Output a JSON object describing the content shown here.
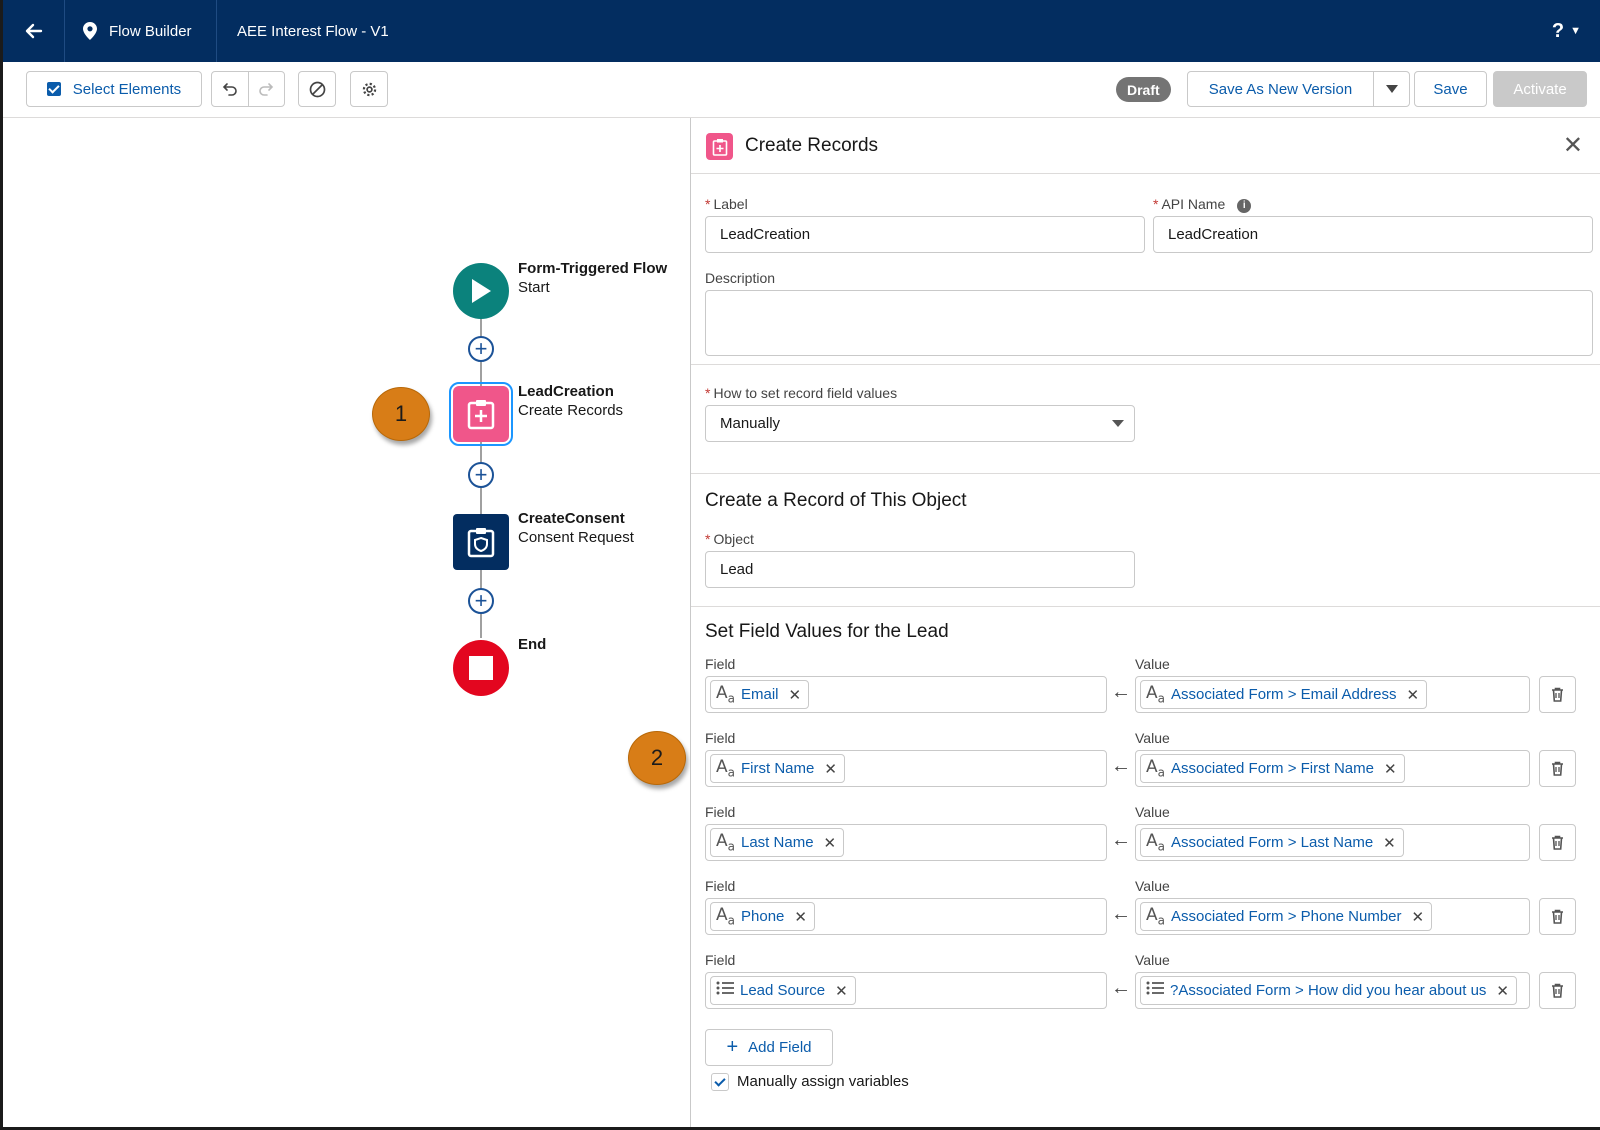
{
  "topbar": {
    "app_name": "Flow Builder",
    "flow_title": "AEE Interest Flow - V1",
    "help_label": "?"
  },
  "toolbar": {
    "select_elements": "Select Elements",
    "status_badge": "Draft",
    "save_as_new_version": "Save As New Version",
    "save": "Save",
    "activate": "Activate"
  },
  "canvas": {
    "start": {
      "title": "Form-Triggered Flow",
      "subtitle": "Start"
    },
    "lead": {
      "title": "LeadCreation",
      "subtitle": "Create Records"
    },
    "consent": {
      "title": "CreateConsent",
      "subtitle": "Consent Request"
    },
    "end": {
      "title": "End"
    },
    "badge_1": "1",
    "badge_2": "2"
  },
  "panel": {
    "title": "Create Records",
    "label_label": "Label",
    "label_value": "LeadCreation",
    "api_name_label": "API Name",
    "api_name_value": "LeadCreation",
    "description_label": "Description",
    "how_to_set_label": "How to set record field values",
    "how_to_set_value": "Manually",
    "object_section_title": "Create a Record of This Object",
    "object_label": "Object",
    "object_value": "Lead",
    "field_values_title": "Set Field Values for the Lead",
    "field_header": "Field",
    "value_header": "Value",
    "rows": [
      {
        "field": "Email",
        "value": "Associated Form > Email Address",
        "icon": "text-type-icon"
      },
      {
        "field": "First Name",
        "value": "Associated Form > First Name",
        "icon": "text-type-icon"
      },
      {
        "field": "Last Name",
        "value": "Associated Form > Last Name",
        "icon": "text-type-icon"
      },
      {
        "field": "Phone",
        "value": "Associated Form > Phone Number",
        "icon": "text-type-icon"
      },
      {
        "field": "Lead Source",
        "value": "?Associated Form > How did you hear about us",
        "icon": "picklist-icon"
      }
    ],
    "add_field": "Add Field",
    "manually_assign": "Manually assign variables",
    "manually_assign_checked": true
  },
  "colors": {
    "topbar": "#032d60",
    "brand_blue": "#0b5cab",
    "start_node": "#0b827c",
    "create_records_node": "#f0568a",
    "consent_node": "#032d60",
    "end_node": "#e3061f",
    "callout_badge": "#d87d17"
  }
}
